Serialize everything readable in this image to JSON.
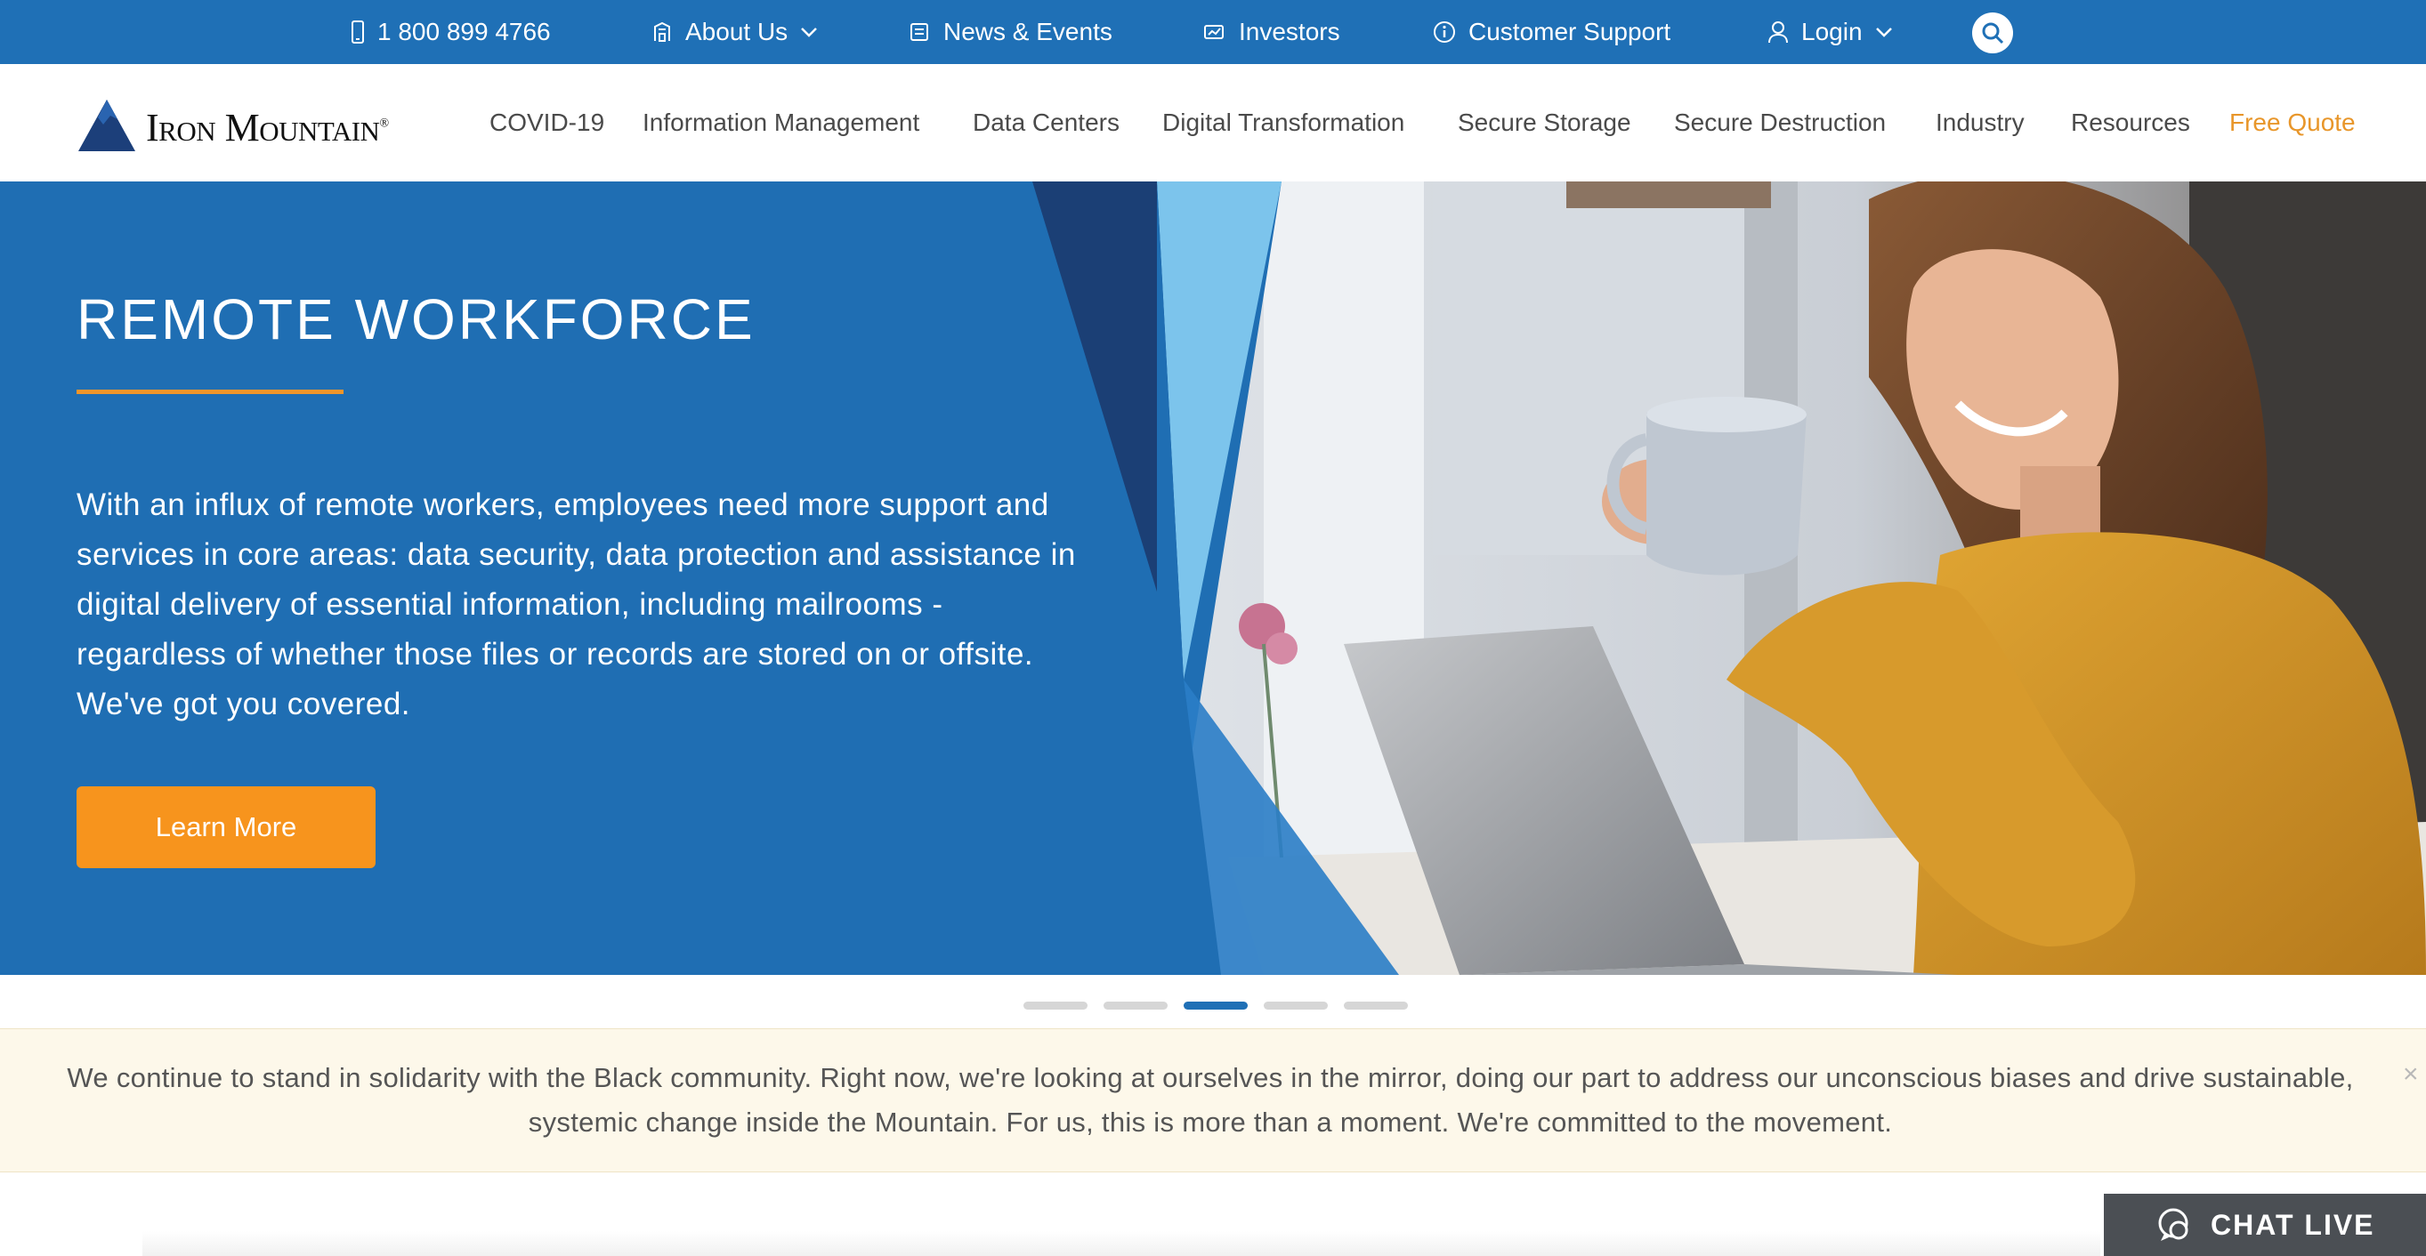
{
  "colors": {
    "brand_blue": "#1f70b6",
    "accent_orange": "#f7941d",
    "notice_background": "#fdf8ea",
    "chat_background": "#4b4f54"
  },
  "utility_bar": {
    "phone": {
      "icon": "phone-icon",
      "label": "1 800 899 4766"
    },
    "about": {
      "icon": "building-icon",
      "label": "About Us",
      "dropdown_icon": "chevron-down-icon"
    },
    "news": {
      "icon": "newspaper-icon",
      "label": "News & Events"
    },
    "investors": {
      "icon": "chart-icon",
      "label": "Investors"
    },
    "support": {
      "icon": "info-icon",
      "label": "Customer Support"
    },
    "login": {
      "icon": "user-icon",
      "label": "Login",
      "dropdown_icon": "chevron-down-icon"
    },
    "search": {
      "icon": "search-icon"
    }
  },
  "logo": {
    "text": "Iron Mountain",
    "registered": "®"
  },
  "main_nav": {
    "items": [
      {
        "label": "COVID-19"
      },
      {
        "label": "Information Management"
      },
      {
        "label": "Data Centers"
      },
      {
        "label": "Digital Transformation"
      },
      {
        "label": "Secure Storage"
      },
      {
        "label": "Secure Destruction"
      },
      {
        "label": "Industry"
      },
      {
        "label": "Resources"
      }
    ],
    "cta": "Free Quote"
  },
  "hero": {
    "title": "REMOTE WORKFORCE",
    "body": "With an influx of remote workers, employees need more support and services in core areas: data security, data protection and assistance in digital delivery of essential information, including mailrooms - regardless of whether those files or records are stored on or offsite. We've got you covered.",
    "button_label": "Learn More"
  },
  "carousel": {
    "total_slides": 5,
    "active_slide": 3
  },
  "notice": {
    "text": "We continue to stand in solidarity with the Black community. Right now, we're looking at ourselves in the mirror, doing our part to address our unconscious biases and drive sustainable, systemic change inside the Mountain. For us, this is more than a moment. We're committed to the movement.",
    "close_label": "×"
  },
  "chat": {
    "icon": "chat-icon",
    "label": "CHAT LIVE"
  }
}
